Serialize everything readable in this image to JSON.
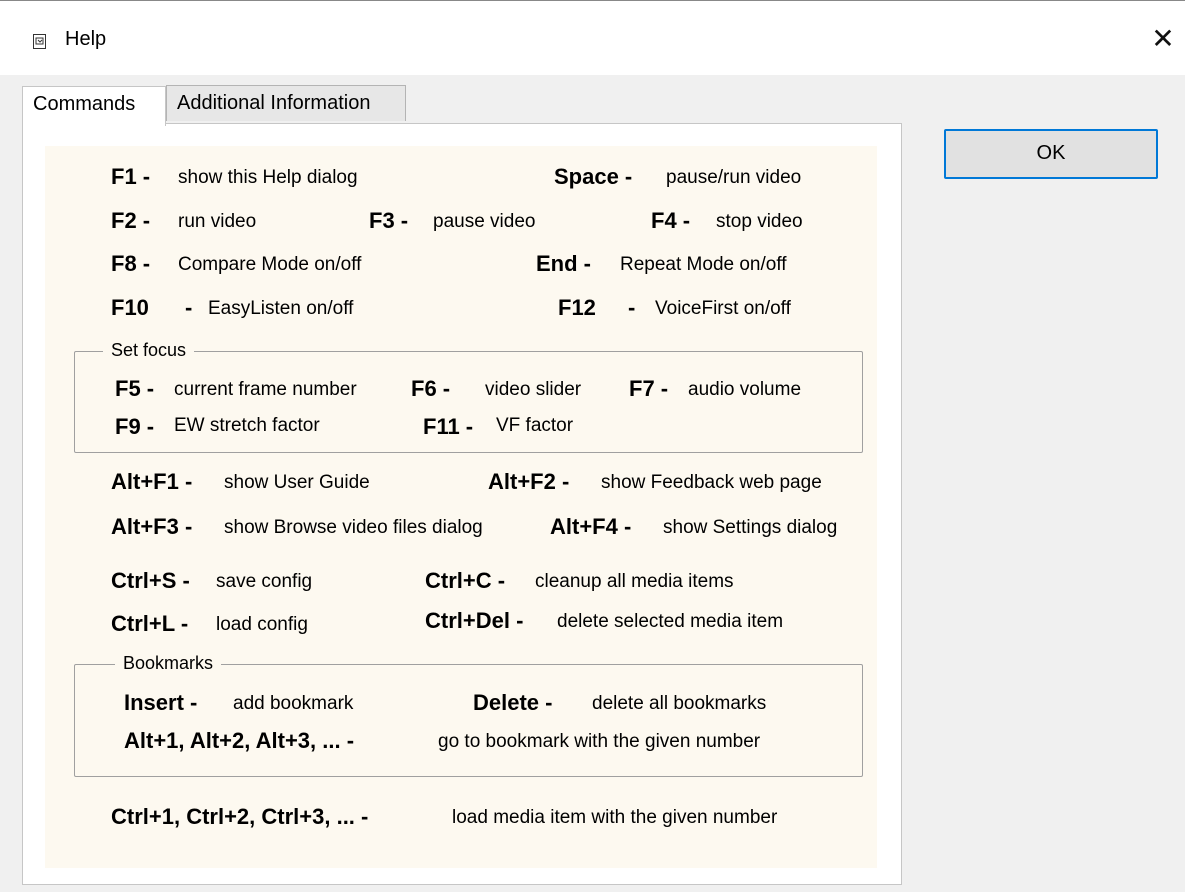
{
  "window": {
    "title": "Help",
    "close_symbol": "✕"
  },
  "tabs": {
    "commands": "Commands",
    "additional": "Additional Information"
  },
  "ok_label": "OK",
  "rows": {
    "f1": {
      "key": "F1 -",
      "desc": "show this Help dialog"
    },
    "space": {
      "key": "Space -",
      "desc": "pause/run video"
    },
    "f2": {
      "key": "F2 -",
      "desc": "run video"
    },
    "f3": {
      "key": "F3 -",
      "desc": "pause video"
    },
    "f4": {
      "key": "F4 -",
      "desc": "stop video"
    },
    "f8": {
      "key": "F8 -",
      "desc": "Compare Mode on/off"
    },
    "end": {
      "key": "End -",
      "desc": "Repeat Mode on/off"
    },
    "f10": {
      "key": "F10",
      "dash": "-",
      "desc": "EasyListen on/off"
    },
    "f12": {
      "key": "F12",
      "dash": "-",
      "desc": "VoiceFirst on/off"
    }
  },
  "set_focus": {
    "legend": "Set focus",
    "f5": {
      "key": "F5 -",
      "desc": "current frame number"
    },
    "f6": {
      "key": "F6 -",
      "desc": "video slider"
    },
    "f7": {
      "key": "F7 -",
      "desc": "audio volume"
    },
    "f9": {
      "key": "F9 -",
      "desc": "EW stretch factor"
    },
    "f11": {
      "key": "F11 -",
      "desc": "VF factor"
    }
  },
  "alt": {
    "altf1": {
      "key": "Alt+F1 -",
      "desc": "show User Guide"
    },
    "altf2": {
      "key": "Alt+F2 -",
      "desc": "show Feedback web page"
    },
    "altf3": {
      "key": "Alt+F3 -",
      "desc": "show Browse video files dialog"
    },
    "altf4": {
      "key": "Alt+F4 -",
      "desc": "show Settings dialog"
    }
  },
  "ctrl": {
    "ctrls": {
      "key": "Ctrl+S -",
      "desc": "save config"
    },
    "ctrlc": {
      "key": "Ctrl+C -",
      "desc": "cleanup all media items"
    },
    "ctrll": {
      "key": "Ctrl+L -",
      "desc": "load config"
    },
    "ctrldel": {
      "key": "Ctrl+Del -",
      "desc": "delete selected media item"
    }
  },
  "bookmarks": {
    "legend": "Bookmarks",
    "insert": {
      "key": "Insert -",
      "desc": "add bookmark"
    },
    "delete": {
      "key": "Delete -",
      "desc": "delete all bookmarks"
    },
    "alt_numbers": {
      "key": "Alt+1, Alt+2, Alt+3, ... -",
      "desc": "go to bookmark with the given number"
    }
  },
  "ctrl_numbers": {
    "key": "Ctrl+1, Ctrl+2, Ctrl+3, ... -",
    "desc": "load media item with the given number"
  }
}
